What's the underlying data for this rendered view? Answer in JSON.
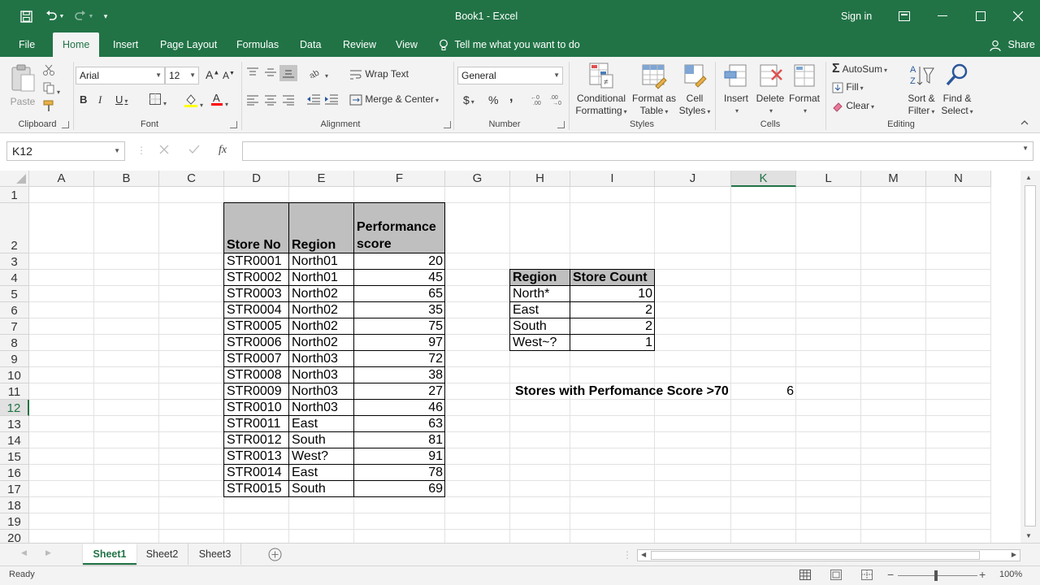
{
  "app": {
    "title": "Book1  -  Excel",
    "sign_in": "Sign in",
    "share": "Share",
    "brand_color": "#217346"
  },
  "tabs": [
    "File",
    "Home",
    "Insert",
    "Page Layout",
    "Formulas",
    "Data",
    "Review",
    "View"
  ],
  "tell_me": "Tell me what you want to do",
  "ribbon": {
    "clipboard": {
      "label": "Clipboard",
      "paste": "Paste"
    },
    "font": {
      "label": "Font",
      "name": "Arial",
      "size": "12",
      "bold": "B",
      "italic": "I",
      "underline": "U"
    },
    "alignment": {
      "label": "Alignment",
      "wrap_text": "Wrap Text",
      "merge_center": "Merge & Center"
    },
    "number": {
      "label": "Number",
      "format": "General",
      "currency": "$",
      "percent": "%",
      "comma": ","
    },
    "styles": {
      "label": "Styles",
      "conditional_formatting": [
        "Conditional",
        "Formatting"
      ],
      "format_as_table": [
        "Format as",
        "Table"
      ],
      "cell_styles": [
        "Cell",
        "Styles"
      ]
    },
    "cells": {
      "label": "Cells",
      "insert": "Insert",
      "delete": "Delete",
      "format": "Format"
    },
    "editing": {
      "label": "Editing",
      "autosum": "AutoSum",
      "fill": "Fill",
      "clear": "Clear",
      "sort_filter": [
        "Sort &",
        "Filter"
      ],
      "find_select": [
        "Find &",
        "Select"
      ]
    }
  },
  "formula_bar": {
    "name_box": "K12",
    "formula": "",
    "fx": "fx"
  },
  "grid": {
    "columns": [
      "A",
      "B",
      "C",
      "D",
      "E",
      "F",
      "G",
      "H",
      "I",
      "J",
      "K",
      "L",
      "M",
      "N"
    ],
    "rows": [
      "1",
      "2",
      "3",
      "4",
      "5",
      "6",
      "7",
      "8",
      "9",
      "10",
      "11",
      "12",
      "13",
      "14",
      "15",
      "16",
      "17",
      "18",
      "19",
      "20"
    ],
    "selected_column": "K",
    "selected_row": "12"
  },
  "table1": {
    "headers": [
      "Store No",
      "Region",
      "Performance",
      "score"
    ],
    "rows": [
      [
        "STR0001",
        "North01",
        "20"
      ],
      [
        "STR0002",
        "North01",
        "45"
      ],
      [
        "STR0003",
        "North02",
        "65"
      ],
      [
        "STR0004",
        "North02",
        "35"
      ],
      [
        "STR0005",
        "North02",
        "75"
      ],
      [
        "STR0006",
        "North02",
        "97"
      ],
      [
        "STR0007",
        "North03",
        "72"
      ],
      [
        "STR0008",
        "North03",
        "38"
      ],
      [
        "STR0009",
        "North03",
        "27"
      ],
      [
        "STR0010",
        "North03",
        "46"
      ],
      [
        "STR0011",
        "East",
        "63"
      ],
      [
        "STR0012",
        "South",
        "81"
      ],
      [
        "STR0013",
        "West?",
        "91"
      ],
      [
        "STR0014",
        "East",
        "78"
      ],
      [
        "STR0015",
        "South",
        "69"
      ]
    ]
  },
  "table2": {
    "headers": [
      "Region",
      "Store Count"
    ],
    "rows": [
      [
        "North*",
        "10"
      ],
      [
        "East",
        "2"
      ],
      [
        "South",
        "2"
      ],
      [
        "West~?",
        "1"
      ]
    ]
  },
  "summary": {
    "label": "Stores with Perfomance Score >70",
    "value": "6"
  },
  "sheets": [
    "Sheet1",
    "Sheet2",
    "Sheet3"
  ],
  "active_sheet": "Sheet1",
  "status": {
    "ready": "Ready",
    "zoom": "100%"
  }
}
